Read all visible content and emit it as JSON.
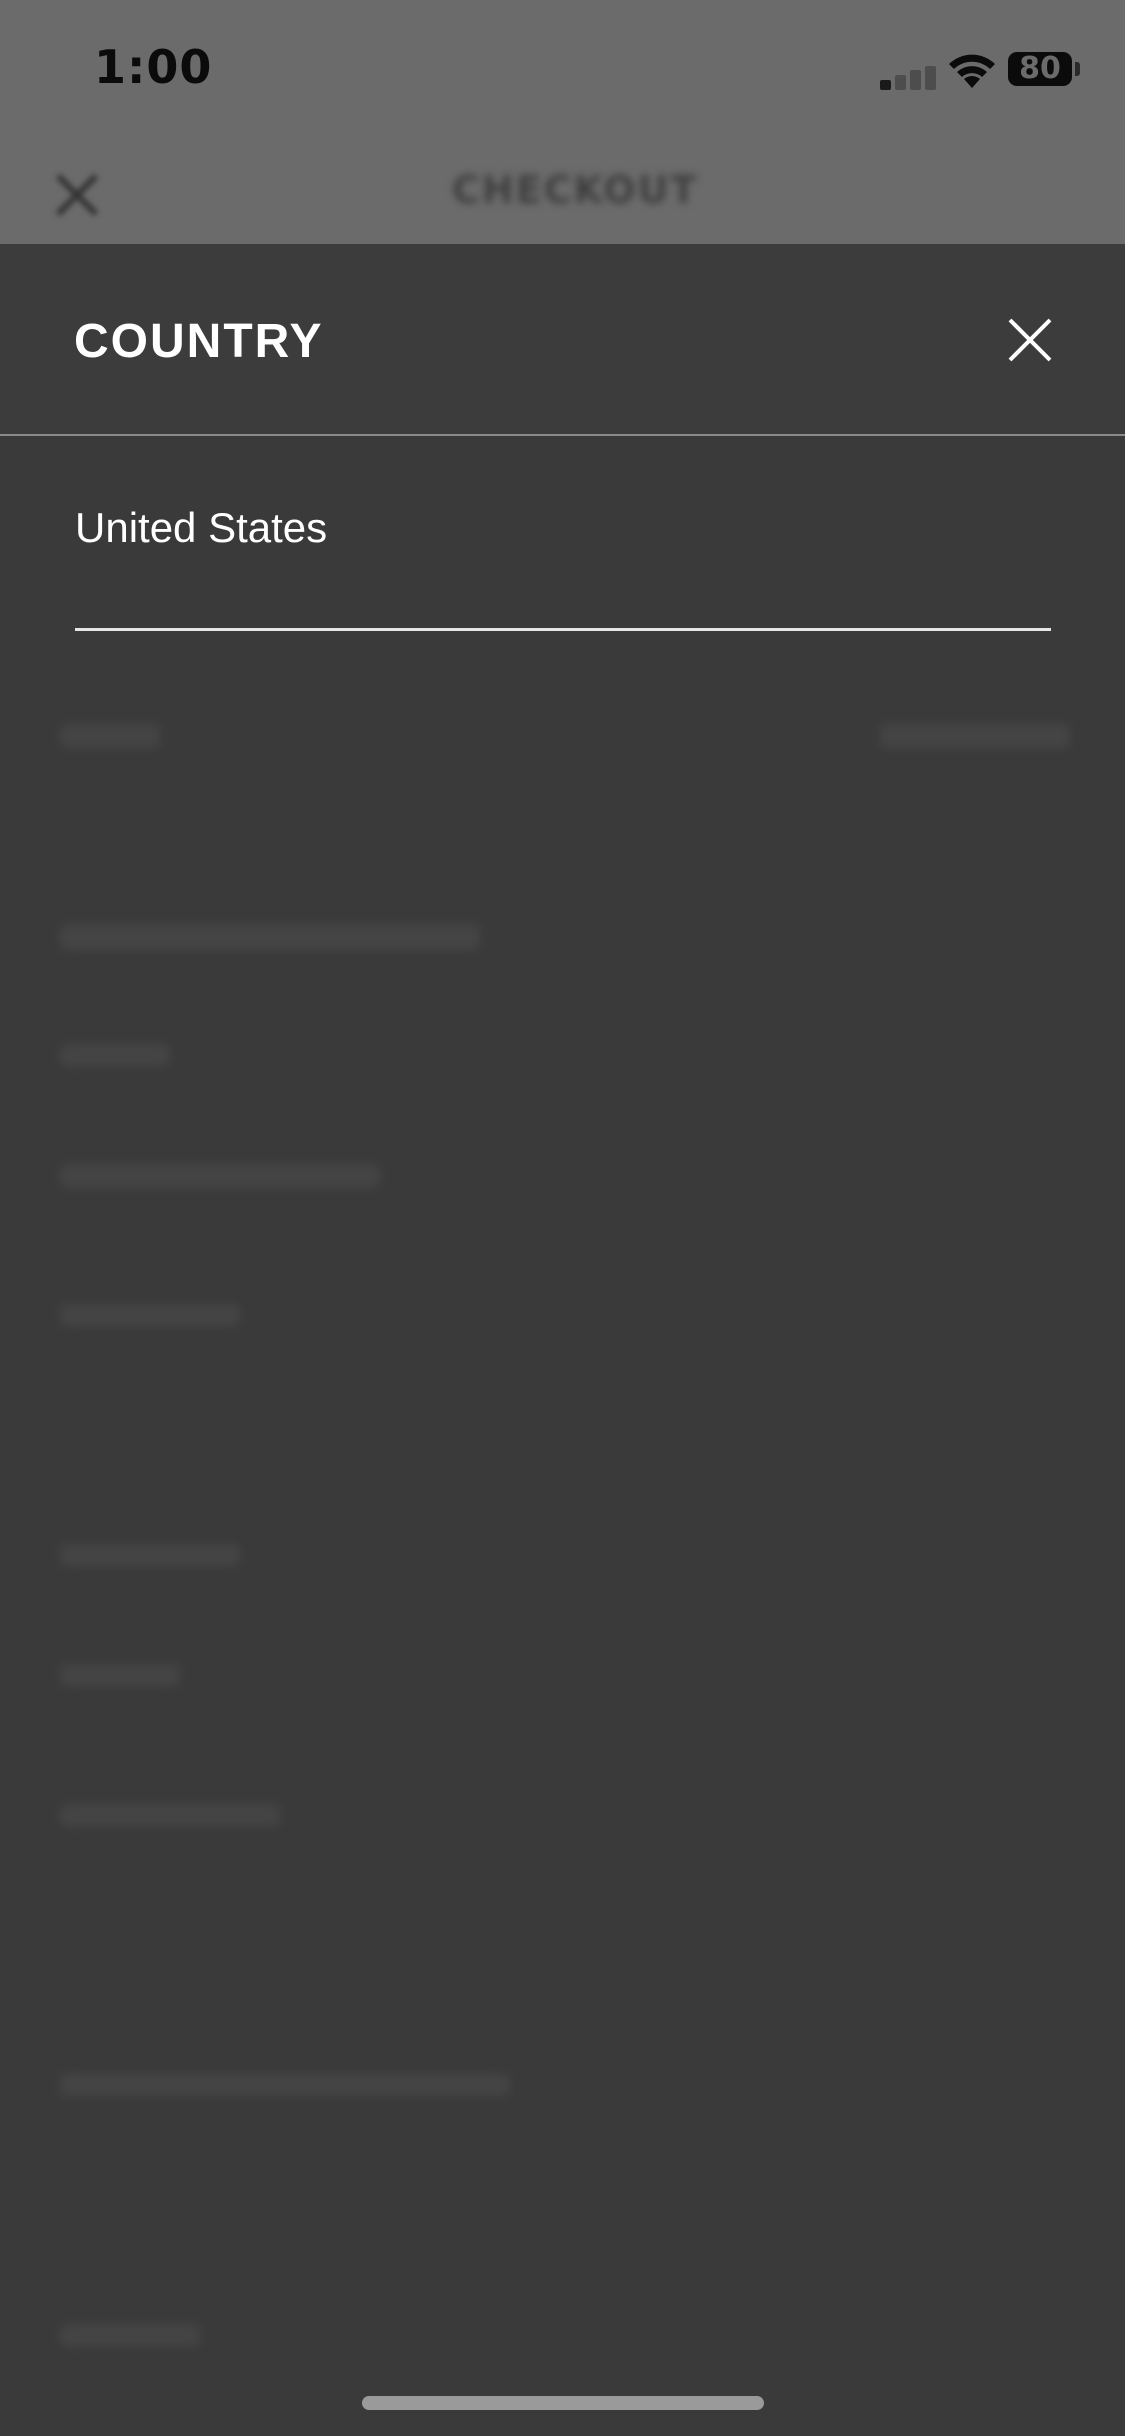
{
  "status_bar": {
    "time": "1:00",
    "battery_level": "80",
    "signal_bars_active": 1
  },
  "background_app": {
    "title": "CHECKOUT",
    "close_icon": "close-icon"
  },
  "modal": {
    "title": "COUNTRY",
    "close_icon": "close-icon",
    "options": [
      {
        "label": "United States"
      }
    ]
  },
  "colors": {
    "overlay": "#3a3a3a",
    "status_bar_dim": "#6b6b6b",
    "text_primary": "#ffffff",
    "divider": "#e6e6e6"
  }
}
